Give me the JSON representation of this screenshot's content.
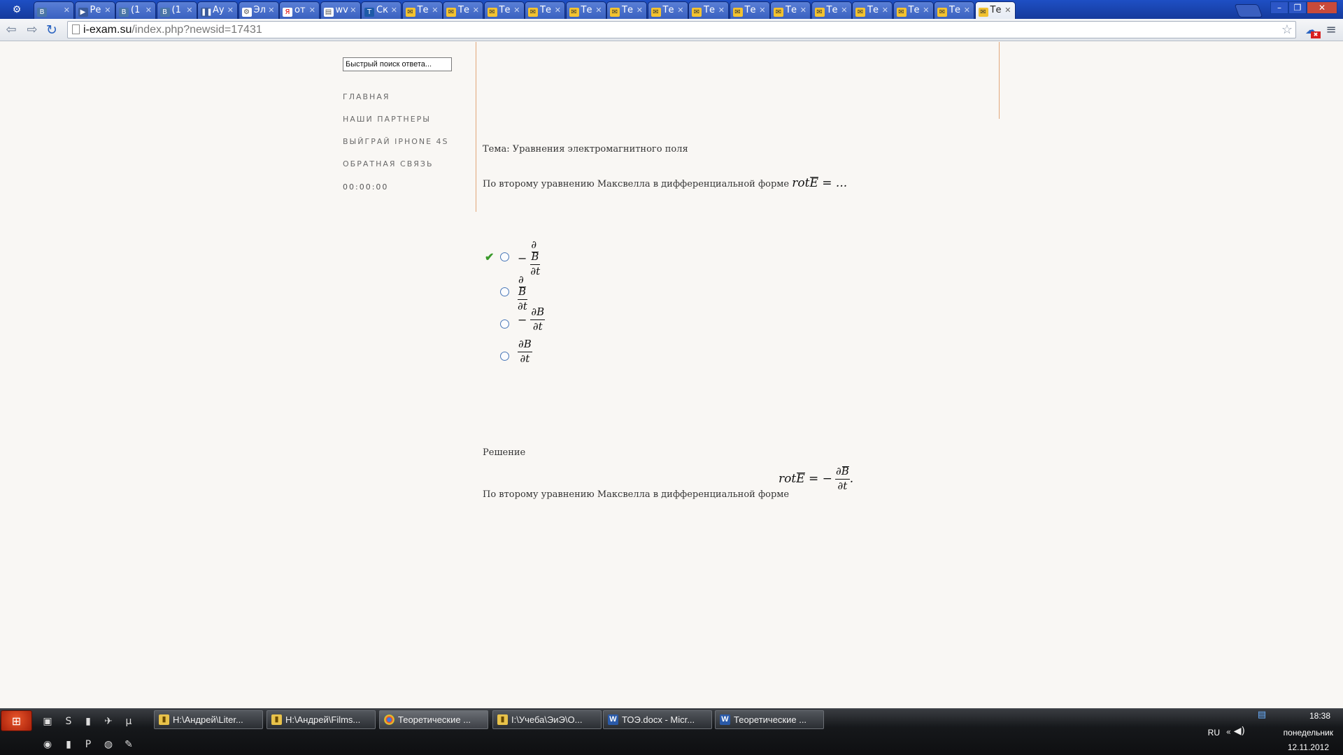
{
  "browser": {
    "tabs": [
      {
        "label": "",
        "icon": "vk",
        "fav": "В"
      },
      {
        "label": "Ре",
        "icon": "play",
        "fav": "▶"
      },
      {
        "label": "(1",
        "icon": "vk",
        "fav": "В"
      },
      {
        "label": "(1",
        "icon": "vk",
        "fav": "В"
      },
      {
        "label": "Ау",
        "icon": "play",
        "fav": "❚❚"
      },
      {
        "label": "Эл",
        "icon": "doc",
        "fav": "⚙"
      },
      {
        "label": "от",
        "icon": "ya",
        "fav": "Я"
      },
      {
        "label": "wv",
        "icon": "doc",
        "fav": "▤"
      },
      {
        "label": "Ск",
        "icon": "t",
        "fav": "T"
      },
      {
        "label": "Те",
        "icon": "mail",
        "fav": "✉"
      },
      {
        "label": "Те",
        "icon": "mail",
        "fav": "✉"
      },
      {
        "label": "Те",
        "icon": "mail",
        "fav": "✉"
      },
      {
        "label": "Те",
        "icon": "mail",
        "fav": "✉"
      },
      {
        "label": "Те",
        "icon": "mail",
        "fav": "✉"
      },
      {
        "label": "Те",
        "icon": "mail",
        "fav": "✉"
      },
      {
        "label": "Те",
        "icon": "mail",
        "fav": "✉"
      },
      {
        "label": "Те",
        "icon": "mail",
        "fav": "✉"
      },
      {
        "label": "Те",
        "icon": "mail",
        "fav": "✉"
      },
      {
        "label": "Те",
        "icon": "mail",
        "fav": "✉"
      },
      {
        "label": "Те",
        "icon": "mail",
        "fav": "✉"
      },
      {
        "label": "Те",
        "icon": "mail",
        "fav": "✉"
      },
      {
        "label": "Те",
        "icon": "mail",
        "fav": "✉"
      },
      {
        "label": "Те",
        "icon": "mail",
        "fav": "✉"
      },
      {
        "label": "Те",
        "icon": "mail",
        "fav": "✉",
        "active": true
      }
    ],
    "url_domain": "i-exam.su",
    "url_path": "/index.php?newsid=17431",
    "window_controls": {
      "minimize": "–",
      "restore": "❐",
      "close": "✕"
    }
  },
  "sidebar": {
    "search_placeholder": "Быстрый поиск ответа...",
    "nav": [
      {
        "label": "ГЛАВНАЯ"
      },
      {
        "label": "НАШИ ПАРТНЕРЫ"
      },
      {
        "label": "ВЫЙГРАЙ IPHONE 4S"
      },
      {
        "label": "ОБРАТНАЯ СВЯЗЬ"
      }
    ],
    "timer": "00:00:00"
  },
  "content": {
    "topic": "Тема: Уравнения электромагнитного поля",
    "question_text": "По второму уравнению Максвелла в дифференциальной форме",
    "question_formula": {
      "lhs": "rot",
      "vec": "E",
      "rhs": "= ..."
    },
    "options": [
      {
        "minus": "−",
        "num": "∂",
        "num_vec": "B",
        "den": "∂t",
        "correct": true,
        "has_minus": true,
        "vector": true
      },
      {
        "minus": "",
        "num": "∂",
        "num_vec": "B",
        "den": "∂t",
        "correct": false,
        "has_minus": false,
        "vector": true
      },
      {
        "minus": "−",
        "num": "∂B",
        "num_vec": "",
        "den": "∂t",
        "correct": false,
        "has_minus": true,
        "vector": false
      },
      {
        "minus": "",
        "num": "∂B",
        "num_vec": "",
        "den": "∂t",
        "correct": false,
        "has_minus": false,
        "vector": false
      }
    ],
    "solution_heading": "Решение",
    "solution_text": "По второму уравнению Максвелла в дифференциальной форме",
    "solution_formula": {
      "lhs": "rot",
      "vec": "E",
      "eq": "= −",
      "num": "∂",
      "num_vec": "B",
      "den": "∂t",
      "tail": "."
    }
  },
  "taskbar": {
    "tasks": [
      {
        "label": "H:\\Андрей\\Liter...",
        "icon": "folder"
      },
      {
        "label": "H:\\Андрей\\Films...",
        "icon": "folder"
      },
      {
        "label": "Теоретические ...",
        "icon": "chrome",
        "active": true
      },
      {
        "label": "I:\\Учеба\\ЭиЭ\\О...",
        "icon": "folder"
      },
      {
        "label": "ТОЭ.docx - Micr...",
        "icon": "word"
      },
      {
        "label": "Теоретические ...",
        "icon": "word"
      }
    ],
    "tray": {
      "lang": "RU",
      "time": "18:38",
      "day": "понедельник",
      "date": "12.11.2012"
    }
  }
}
